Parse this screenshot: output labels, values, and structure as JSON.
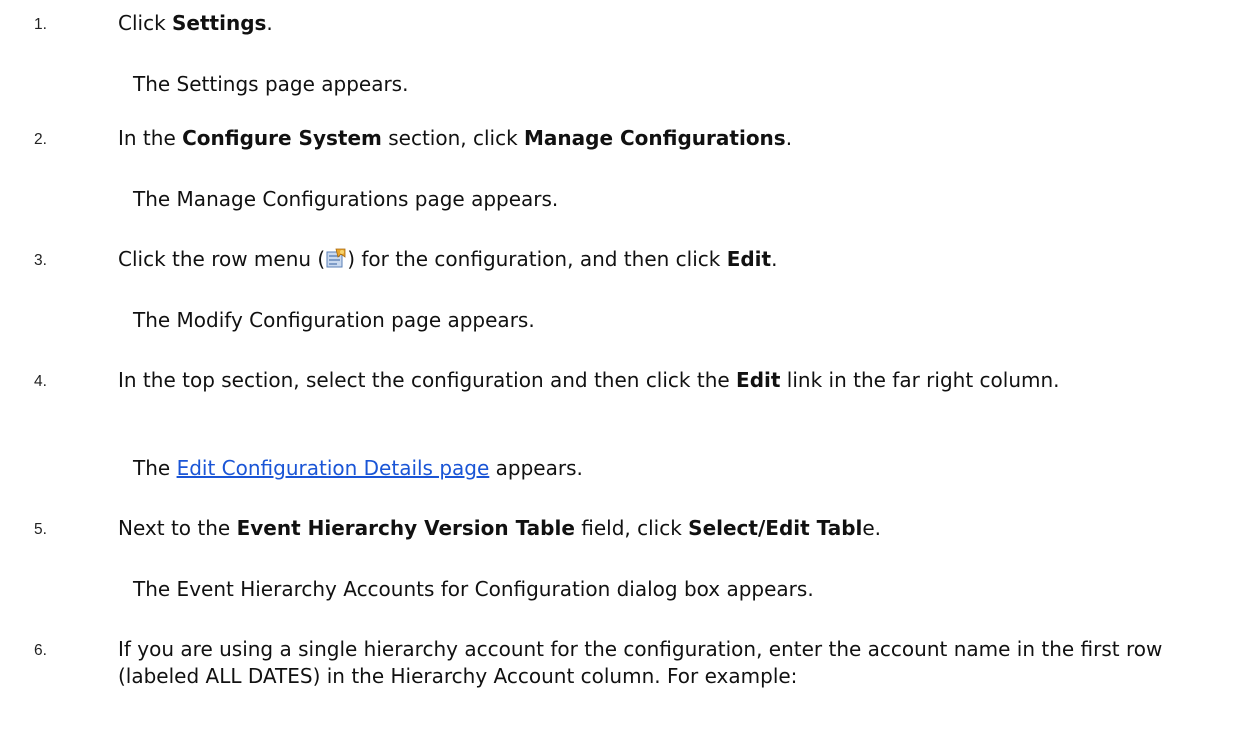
{
  "steps": [
    {
      "number": "1.",
      "pre": "Click ",
      "bold": "Settings",
      "post": ".",
      "result": "The Settings page appears."
    },
    {
      "number": "2.",
      "pre": "In the ",
      "bold1": "Configure System",
      "mid": " section, click ",
      "bold2": "Manage Configurations",
      "post": ".",
      "result": "The Manage Configurations page appears."
    },
    {
      "number": "3.",
      "pre": "Click the row menu (",
      "icon": "row-menu-icon",
      "mid": ") for the configuration, and then click ",
      "bold": "Edit",
      "post": ".",
      "result": "The Modify Configuration page appears."
    },
    {
      "number": "4.",
      "pre": "In the top section, select the configuration and then click the ",
      "bold": "Edit",
      "post": " link in the far right column.",
      "result_pre": "The ",
      "result_link": "Edit Configuration Details page",
      "result_post": " appears."
    },
    {
      "number": "5.",
      "pre": "Next to the ",
      "bold1": "Event Hierarchy Version Table",
      "mid": " field, click ",
      "bold2": "Select/Edit Tabl",
      "post": "e.",
      "result": "The Event Hierarchy Accounts for Configuration dialog box appears."
    },
    {
      "number": "6.",
      "text": "If you are using a single hierarchy account for the configuration, enter the account name in the first row (labeled ALL DATES) in the Hierarchy Account column. For example:"
    }
  ],
  "colors": {
    "link": "#1a55d6",
    "text": "#111111"
  }
}
